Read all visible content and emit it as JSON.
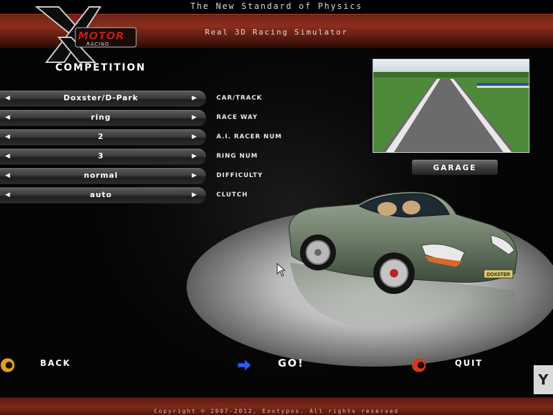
{
  "header": {
    "tagline": "The New Standard of Physics",
    "subtitle": "Real 3D Racing Simulator"
  },
  "logo": {
    "word": "MOTOR",
    "sub": "RACING"
  },
  "section_title": "COMPETITION",
  "options": [
    {
      "value": "Doxster/D-Park",
      "label": "CAR/TRACK"
    },
    {
      "value": "ring",
      "label": "RACE WAY"
    },
    {
      "value": "2",
      "label": "A.I. RACER NUM"
    },
    {
      "value": "3",
      "label": "RING NUM"
    },
    {
      "value": "normal",
      "label": "DIFFICULTY"
    },
    {
      "value": "auto",
      "label": "CLUTCH"
    }
  ],
  "garage_label": "GARAGE",
  "car_plate": "DOXSTER",
  "nav": {
    "back": "BACK",
    "go": "GO!",
    "quit": "QUIT"
  },
  "corner_badge": "Y",
  "footer": {
    "copyright": "Copyright © 2007-2012, Exotypos. All rights reserved"
  },
  "colors": {
    "header_band": "#8b2e1c",
    "logo_red": "#c01e12",
    "back_icon": "#e0a020",
    "go_arrow": "#2c5cff",
    "quit_icon": "#d23a1a",
    "car_body": "#7a8a74"
  }
}
